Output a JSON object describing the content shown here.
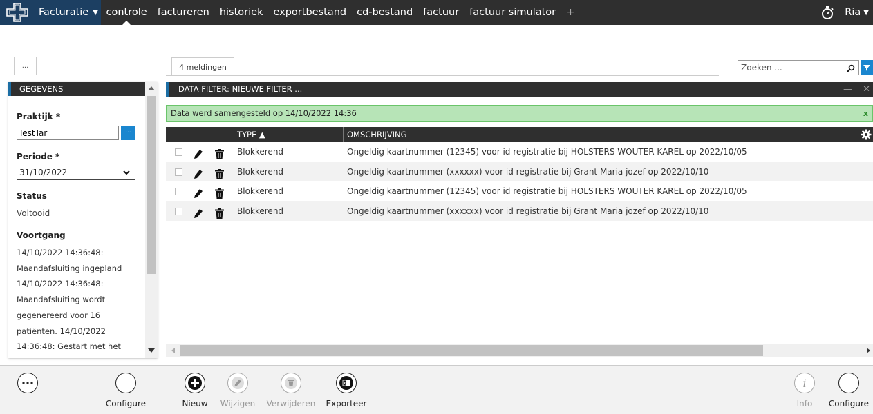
{
  "nav": {
    "app_title": "Facturatie",
    "links": [
      "controle",
      "factureren",
      "historiek",
      "exportbestand",
      "cd-bestand",
      "factuur",
      "factuur simulator"
    ],
    "add_label": "+",
    "user_name": "Ria"
  },
  "left": {
    "tab_label": "...",
    "header": "GEGEVENS",
    "praktijk_label": "Praktijk *",
    "praktijk_value": "TestTar",
    "praktijk_button": "...",
    "periode_label": "Periode *",
    "periode_value": "31/10/2022",
    "status_label": "Status",
    "status_value": "Voltooid",
    "voortgang_label": "Voortgang",
    "voortgang_text": "14/10/2022 14:36:48: Maandafsluiting ingepland 14/10/2022 14:36:48: Maandafsluiting wordt gegenereerd voor 16 patiënten. 14/10/2022 14:36:48: Gestart met het controleren van de"
  },
  "main": {
    "tab_label": "4 meldingen",
    "search_placeholder": "Zoeken ...",
    "filter_header": "DATA FILTER: NIEUWE FILTER ...",
    "notice": "Data werd samengesteld op 14/10/2022 14:36",
    "notice_close": "x",
    "col_type": "TYPE ▲",
    "col_desc": "OMSCHRIJVING",
    "rows": [
      {
        "type": "Blokkerend",
        "desc": "Ongeldig kaartnummer (12345) voor id registratie bij HOLSTERS WOUTER KAREL op 2022/10/05"
      },
      {
        "type": "Blokkerend",
        "desc": "Ongeldig kaartnummer (xxxxxx) voor id registratie bij Grant Maria jozef op 2022/10/10"
      },
      {
        "type": "Blokkerend",
        "desc": "Ongeldig kaartnummer (12345) voor id registratie bij HOLSTERS WOUTER KAREL op 2022/10/05"
      },
      {
        "type": "Blokkerend",
        "desc": "Ongeldig kaartnummer (xxxxxx) voor id registratie bij Grant Maria jozef op 2022/10/10"
      }
    ]
  },
  "toolbar": {
    "configure_left": "Configure",
    "nieuw": "Nieuw",
    "wijzigen": "Wijzigen",
    "verwijderen": "Verwijderen",
    "exporteer": "Exporteer",
    "info": "Info",
    "configure_right": "Configure"
  },
  "colors": {
    "brand": "#1c3f62",
    "accent": "#1a86cf",
    "topbar": "#2f2f2f",
    "notice_bg": "#b7e4b7"
  }
}
